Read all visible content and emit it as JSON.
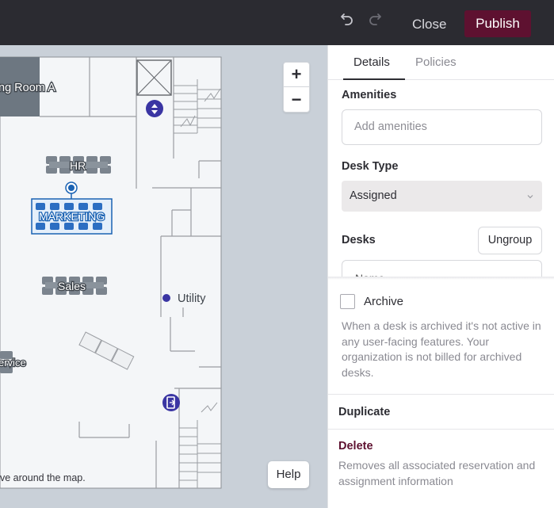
{
  "topbar": {
    "undo_icon": "undo-icon",
    "redo_icon": "redo-icon",
    "close_label": "Close",
    "publish_label": "Publish",
    "accent": "#5e1130"
  },
  "map": {
    "rooms": {
      "meeting_room": "ng Room A",
      "hr": "HR",
      "marketing": "MARKETING",
      "sales": "Sales",
      "utility": "Utility",
      "service": "ervice"
    },
    "hint": "ve around the map.",
    "zoom_in": "+",
    "zoom_out": "−",
    "help_label": "Help"
  },
  "panel": {
    "tabs": [
      "Details",
      "Policies"
    ],
    "active_tab": "Details",
    "amenities_label": "Amenities",
    "amenities_placeholder": "Add amenities",
    "desk_type_label": "Desk Type",
    "desk_type_value": "Assigned",
    "desks_label": "Desks",
    "ungroup_label": "Ungroup",
    "name_header": "Name",
    "archive_label": "Archive",
    "archive_checked": false,
    "archive_desc": "When a desk is archived it's not active in any user-facing features. Your organization is not billed for archived desks.",
    "duplicate_label": "Duplicate",
    "delete_label": "Delete",
    "delete_desc": "Removes all associated reservation and assignment information"
  }
}
